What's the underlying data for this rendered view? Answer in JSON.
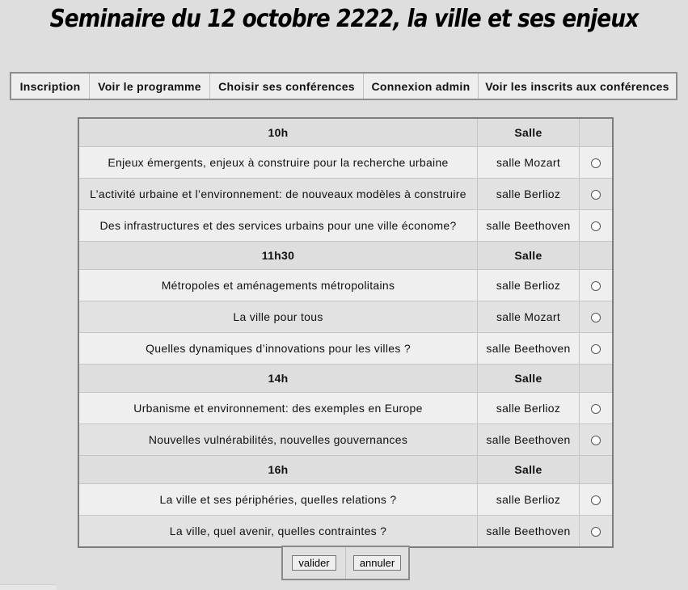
{
  "title": "Seminaire du 12 octobre 2222, la ville et ses enjeux",
  "nav": [
    "Inscription",
    "Voir le programme",
    "Choisir ses conférences",
    "Connexion admin",
    "Voir les inscrits aux conférences"
  ],
  "room_header": "Salle",
  "sessions": [
    {
      "time": "10h",
      "talks": [
        {
          "title": "Enjeux émergents, enjeux à construire pour la recherche urbaine",
          "room": "salle Mozart"
        },
        {
          "title": "L’activité urbaine et l’environnement: de nouveaux modèles à construire",
          "room": "salle Berlioz"
        },
        {
          "title": "Des infrastructures et des services urbains pour une ville économe?",
          "room": "salle Beethoven"
        }
      ]
    },
    {
      "time": "11h30",
      "talks": [
        {
          "title": "Métropoles et aménagements métropolitains",
          "room": "salle Berlioz"
        },
        {
          "title": "La ville pour tous",
          "room": "salle Mozart"
        },
        {
          "title": "Quelles dynamiques d’innovations pour les villes ?",
          "room": "salle Beethoven"
        }
      ]
    },
    {
      "time": "14h",
      "talks": [
        {
          "title": "Urbanisme et environnement: des exemples en Europe",
          "room": "salle Berlioz"
        },
        {
          "title": "Nouvelles vulnérabilités, nouvelles gouvernances",
          "room": "salle Beethoven"
        }
      ]
    },
    {
      "time": "16h",
      "talks": [
        {
          "title": "La ville et ses périphéries, quelles relations ?",
          "room": "salle Berlioz"
        },
        {
          "title": "La ville, quel avenir, quelles contraintes ?",
          "room": "salle Beethoven"
        }
      ]
    }
  ],
  "buttons": {
    "submit": "valider",
    "cancel": "annuler"
  }
}
